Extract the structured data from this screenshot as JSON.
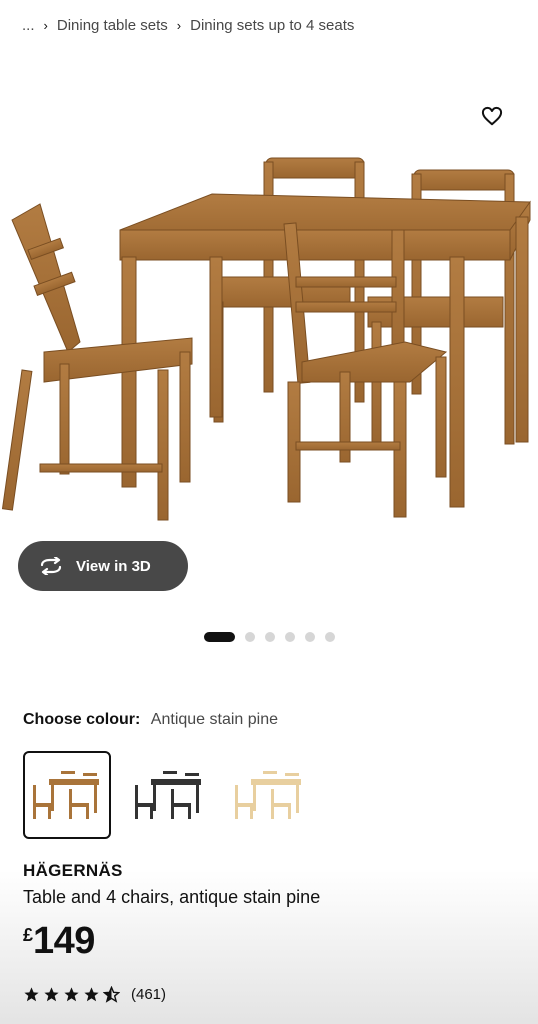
{
  "breadcrumb": {
    "ellipsis": "...",
    "items": [
      "Dining table sets",
      "Dining sets up to 4 seats"
    ]
  },
  "gallery": {
    "view_3d_label": "View in 3D",
    "total_images": 6,
    "active_index": 0,
    "favourite_icon": "heart-outline-icon"
  },
  "colour": {
    "label": "Choose colour:",
    "selected": "Antique stain pine",
    "options": [
      {
        "name": "Antique stain pine",
        "color": "#a9743a",
        "selected": true
      },
      {
        "name": "Black",
        "color": "#333333",
        "selected": false
      },
      {
        "name": "Natural pine",
        "color": "#e8cf9f",
        "selected": false
      }
    ]
  },
  "product": {
    "name": "HÄGERNÄS",
    "description": "Table and 4 chairs, antique stain pine",
    "price_currency": "£",
    "price_amount": "149",
    "rating_stars": 4.5,
    "review_count": "(461)"
  },
  "colors": {
    "wood": "#a9743a",
    "button_bg": "#484848",
    "active_dot": "#111111",
    "inactive_dot": "#d6d6d6"
  }
}
